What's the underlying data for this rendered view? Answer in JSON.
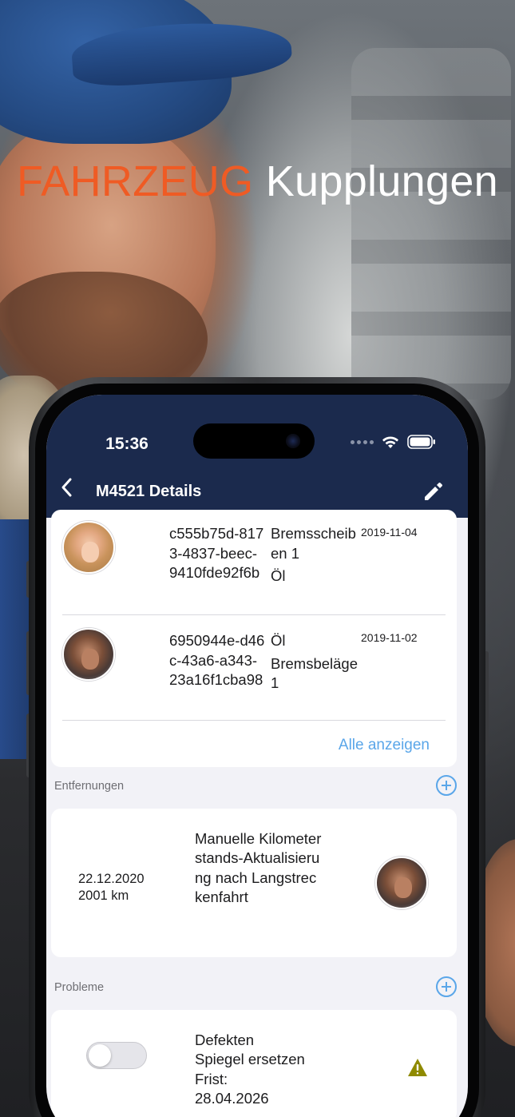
{
  "headline": {
    "word1": "FAHRZEUG",
    "word2": "Kupplungen"
  },
  "colors": {
    "accent": "#ef5b24",
    "nav": "#1b2a4d",
    "link": "#5aa6e9",
    "warning": "#8f8a00"
  },
  "status_bar": {
    "time": "15:36",
    "icons": [
      "signal-dots-icon",
      "wifi-icon",
      "battery-icon"
    ]
  },
  "nav": {
    "title": "M4521 Details",
    "back_icon": "chevron-left-icon",
    "edit_icon": "pencil-icon"
  },
  "history": {
    "rows": [
      {
        "avatar": "avatar-female",
        "id": "c555b75d-8173-4837-beec-9410fde92f6b",
        "tags": [
          "Bremsscheiben 1",
          "Öl"
        ],
        "date": "2019-11-04"
      },
      {
        "avatar": "avatar-male",
        "id": "6950944e-d46c-43a6-a343-23a16f1cba98",
        "tags": [
          "Öl",
          "Bremsbeläge 1"
        ],
        "date": "2019-11-02"
      }
    ],
    "show_all": "Alle anzeigen"
  },
  "removals": {
    "title": "Entfernungen",
    "item": {
      "date": "22.12.2020",
      "km": "2001 km",
      "description": "Manuelle Kilometerstands-Aktualisierung nach Langstreckenfahrt",
      "avatar": "avatar-male"
    }
  },
  "problems": {
    "title": "Probleme",
    "item": {
      "line1": "Defekten",
      "line2": "Spiegel ersetzen",
      "line3": "Frist:",
      "line4": "28.04.2026",
      "toggle_on": false,
      "icon": "warning-icon"
    }
  }
}
